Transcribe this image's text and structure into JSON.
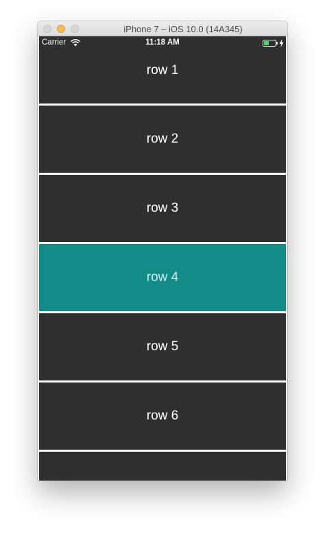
{
  "window": {
    "title": "iPhone 7 – iOS 10.0 (14A345)"
  },
  "status_bar": {
    "carrier": "Carrier",
    "time": "11:18 AM",
    "icons": [
      "wifi-icon",
      "battery-icon",
      "charging-bolt-icon"
    ]
  },
  "rows": [
    {
      "label": "row 1",
      "selected": false
    },
    {
      "label": "row 2",
      "selected": false
    },
    {
      "label": "row 3",
      "selected": false
    },
    {
      "label": "row 4",
      "selected": true
    },
    {
      "label": "row 5",
      "selected": false
    },
    {
      "label": "row 6",
      "selected": false
    },
    {
      "label": "",
      "selected": false
    }
  ],
  "colors": {
    "row_background": "#2f2f2f",
    "selected_row_background": "#138b88",
    "separator": "#ffffff",
    "minimize_button": "#f5bd4f"
  }
}
